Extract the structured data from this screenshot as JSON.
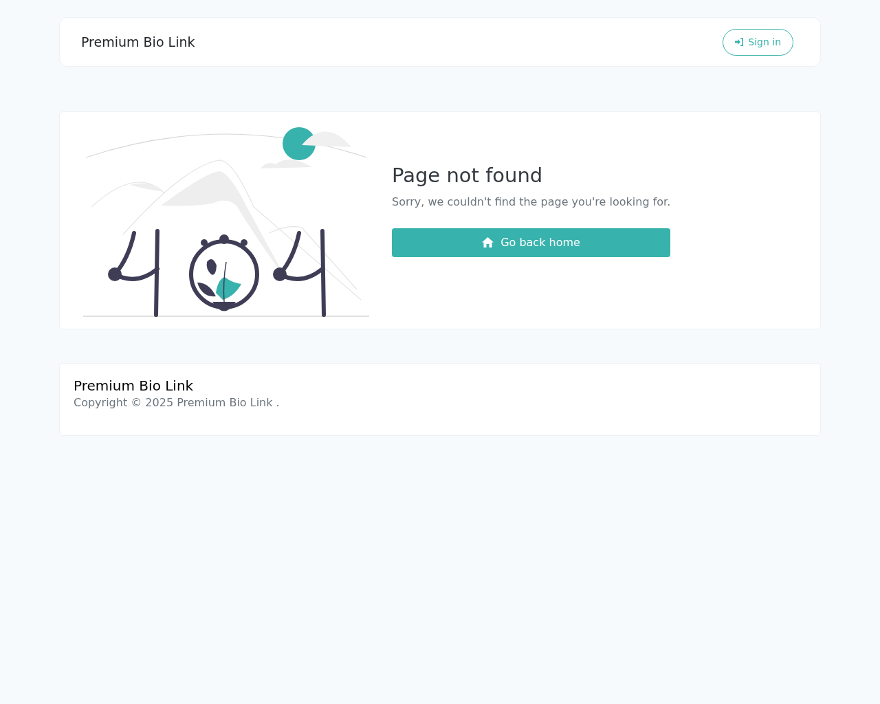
{
  "header": {
    "brand": "Premium Bio Link",
    "sign_in": "Sign in"
  },
  "error": {
    "title": "Page not found",
    "message": "Sorry, we couldn't find the page you're looking for.",
    "button": "Go back home"
  },
  "footer": {
    "brand": "Premium Bio Link",
    "copyright": "Copyright © 2025 Premium Bio Link ."
  }
}
